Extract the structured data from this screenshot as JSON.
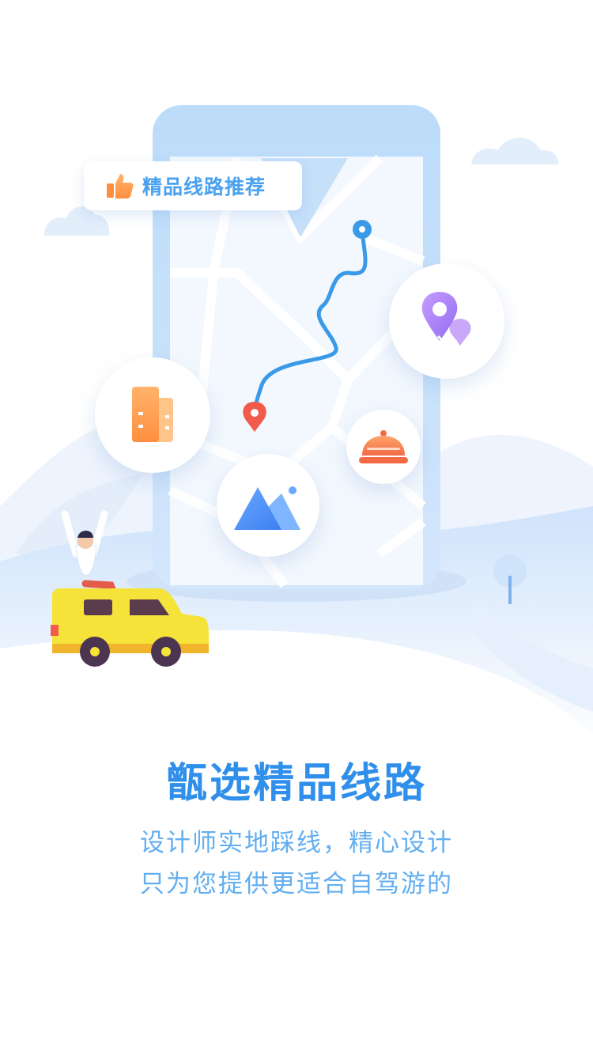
{
  "badge": {
    "label": "精品线路推荐",
    "icon": "thumbs-up-icon"
  },
  "icons": {
    "location": "location-pin-icon",
    "buildings": "buildings-icon",
    "restaurant": "dining-cloche-icon",
    "scenery": "mountain-icon"
  },
  "title": "甑选精品线路",
  "subtitle": {
    "line1": "设计师实地踩线，精心设计",
    "line2": "只为您提供更适合自驾游的"
  },
  "colors": {
    "title": "#2f8fea",
    "subtitle": "#62aef0",
    "route": "#3a9ae8",
    "car": "#f5e33a"
  }
}
